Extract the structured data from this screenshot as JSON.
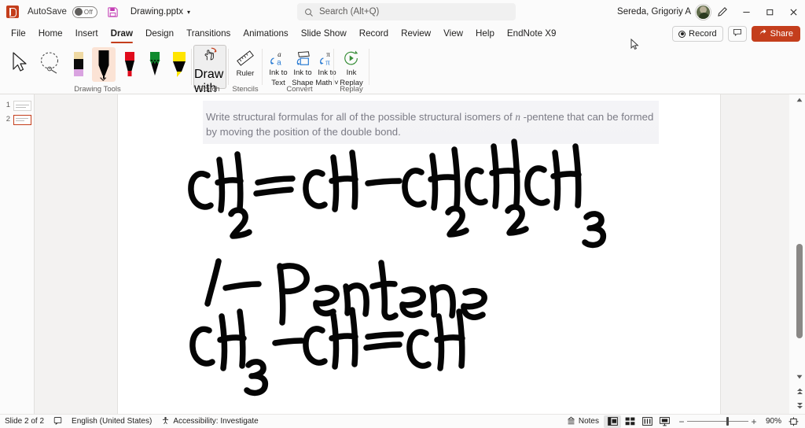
{
  "titlebar": {
    "app_logo": "powerpoint-logo",
    "autosave_label": "AutoSave",
    "autosave_state": "Off",
    "save_icon": "save-icon",
    "document_name": "Drawing.pptx",
    "doc_caret": "▾",
    "user_name": "Sereda, Grigoriy A",
    "pen_icon": "pen-icon",
    "minimize": "—",
    "restore": "▢",
    "close": "✕"
  },
  "search": {
    "placeholder": "Search (Alt+Q)",
    "value": "",
    "icon": "search-icon"
  },
  "tabs": [
    {
      "label": "File",
      "active": false
    },
    {
      "label": "Home",
      "active": false
    },
    {
      "label": "Insert",
      "active": false
    },
    {
      "label": "Draw",
      "active": true
    },
    {
      "label": "Design",
      "active": false
    },
    {
      "label": "Transitions",
      "active": false
    },
    {
      "label": "Animations",
      "active": false
    },
    {
      "label": "Slide Show",
      "active": false
    },
    {
      "label": "Record",
      "active": false
    },
    {
      "label": "Review",
      "active": false
    },
    {
      "label": "View",
      "active": false
    },
    {
      "label": "Help",
      "active": false
    },
    {
      "label": "EndNote X9",
      "active": false
    }
  ],
  "tabstrip_right": {
    "record_label": "Record",
    "comment_icon": "comment-icon",
    "share_label": "Share",
    "share_color": "#c43e1c"
  },
  "ribbon": {
    "groups": [
      {
        "name": "drawing-tools",
        "label": "Drawing Tools"
      },
      {
        "name": "touch",
        "label": "Touch"
      },
      {
        "name": "stencils",
        "label": "Stencils"
      },
      {
        "name": "convert",
        "label": "Convert"
      },
      {
        "name": "replay",
        "label": "Replay"
      }
    ],
    "drawing_tools": [
      {
        "name": "select-tool",
        "tooltip": "Select",
        "selected": false
      },
      {
        "name": "lasso-select-tool",
        "tooltip": "Lasso Select",
        "selected": false
      },
      {
        "name": "eraser-tool",
        "tooltip": "Eraser",
        "selected": false,
        "color": "#d9b3dd"
      },
      {
        "name": "pen-black",
        "tooltip": "Pen",
        "selected": true,
        "color": "#000000"
      },
      {
        "name": "pen-red",
        "tooltip": "Pen Red",
        "selected": false,
        "color": "#e00b1c"
      },
      {
        "name": "pen-green",
        "tooltip": "Pencil Green",
        "selected": false,
        "color": "#108a2e"
      },
      {
        "name": "highlighter-yellow",
        "tooltip": "Highlighter",
        "selected": false,
        "color": "#ffe500"
      }
    ],
    "commands": [
      {
        "name": "draw-with-touch",
        "label_line1": "Draw with",
        "label_line2": "Touch",
        "toggled": true
      },
      {
        "name": "ruler",
        "label_line1": "Ruler",
        "label_line2": ""
      },
      {
        "name": "ink-to-text",
        "label_line1": "Ink to",
        "label_line2": "Text"
      },
      {
        "name": "ink-to-shape",
        "label_line1": "Ink to",
        "label_line2": "Shape"
      },
      {
        "name": "ink-to-math",
        "label_line1": "Ink to",
        "label_line2": "Math ˅"
      },
      {
        "name": "ink-replay",
        "label_line1": "Ink",
        "label_line2": "Replay"
      }
    ],
    "collapse_icon": "chevron-down-icon"
  },
  "thumbnails": [
    {
      "number": "1",
      "selected": false
    },
    {
      "number": "2",
      "selected": true
    }
  ],
  "slide": {
    "text_part1": "Write structural formulas for all of the possible structural isomers of ",
    "text_italic": "n",
    "text_part2": " -pentene that can be formed by moving the position of the double bond.",
    "ink_lines": [
      "CH2= CH - CH2CH2CH3",
      "1- Pentene",
      "CH3 - CH = CH"
    ],
    "ink_color": "#050505"
  },
  "scrollbar": {
    "up_arrow": "▲",
    "down_arrow": "▼",
    "prev_slide": "⏶",
    "next_slide": "⏷"
  },
  "statusbar": {
    "slide_counter": "Slide 2 of 2",
    "notes_icon": "notes-icon",
    "language": "English (United States)",
    "accessibility": "Accessibility: Investigate",
    "notes_label": "Notes",
    "views": [
      {
        "name": "normal-view",
        "active": true
      },
      {
        "name": "slide-sorter-view",
        "active": false
      },
      {
        "name": "reading-view",
        "active": false
      },
      {
        "name": "slideshow-view",
        "active": false
      }
    ],
    "zoom_out": "−",
    "zoom_in": "+",
    "zoom_level": "90%",
    "fit_slide": "fit-to-window-icon"
  }
}
